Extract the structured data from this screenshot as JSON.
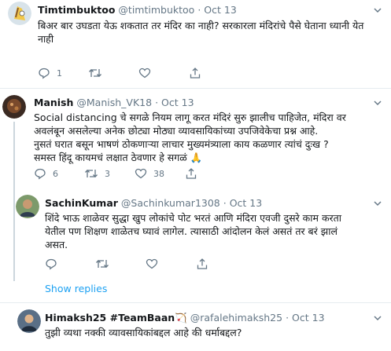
{
  "tweets": [
    {
      "name": "Timtimbuktoo",
      "handle": "@timtimbuktoo",
      "dot": "·",
      "time": "Oct 13",
      "lines": [
        "बिअर बार उघडता येऊ शकतात तर मंदिर का नाही? सरकारला मंदिरांचे पैसे घेताना ध्यानी येत",
        "नाही"
      ],
      "reply_count": "1",
      "retweet_count": "",
      "like_count": ""
    },
    {
      "name": "Manish",
      "handle": "@Manish_VK18",
      "dot": "·",
      "time": "Oct 13",
      "lines": [
        "Social distancing चे सगळे नियम लागू करत मंदिरं सुरु झालीच पाहिजेत, मंदिरा वर",
        "अवलंबून असलेल्या अनेक छोट्या मोठ्या व्यावसायिकांच्या उपजिवेकेचा प्रश्न आहे.",
        "नुसतं घरात बसून भाषणं ठोकणाऱ्या लाचार मुख्यमंत्र्याला काय कळणार त्यांचं दुःख ?",
        "समस्त हिंदू कायमचं लक्षात ठेवणार हे सगळं"
      ],
      "emoji": "🙏",
      "reply_count": "6",
      "retweet_count": "3",
      "like_count": "38"
    },
    {
      "name": "SachinKumar",
      "handle": "@Sachinkumar1308",
      "dot": "·",
      "time": "Oct 13",
      "lines": [
        "शिंदे भाऊ शाळेवर सुद्धा खुप लोकांचे पोट भरतं आणि मंदिरा एवजी दुसरे काम करता",
        "येतील पण शिक्षण शाळेतच घ्यावं लागेल. त्यासाठी आंदोलन केलं असतं तर बरं झालं",
        "असत."
      ],
      "reply_count": "",
      "retweet_count": "",
      "like_count": ""
    },
    {
      "name": "Himaksh25 #TeamBaan",
      "name_emoji": "🏹",
      "handle": "@rafalehimaksh25",
      "dot": "·",
      "time": "Oct 13",
      "lines": [
        "तुझी व्यथा नक्की व्यावसायिकांबद्दल आहे की धर्माबद्दल?"
      ]
    }
  ],
  "show_replies_label": "Show replies",
  "colors": {
    "link": "#1da1f2",
    "secondary_text": "#657786",
    "divider": "#e6ecf0",
    "thread_line": "#ccd6dd"
  },
  "icons": [
    "reply-icon",
    "retweet-icon",
    "like-icon",
    "share-icon",
    "praying-hands-emoji",
    "bow-and-arrow-emoji"
  ]
}
